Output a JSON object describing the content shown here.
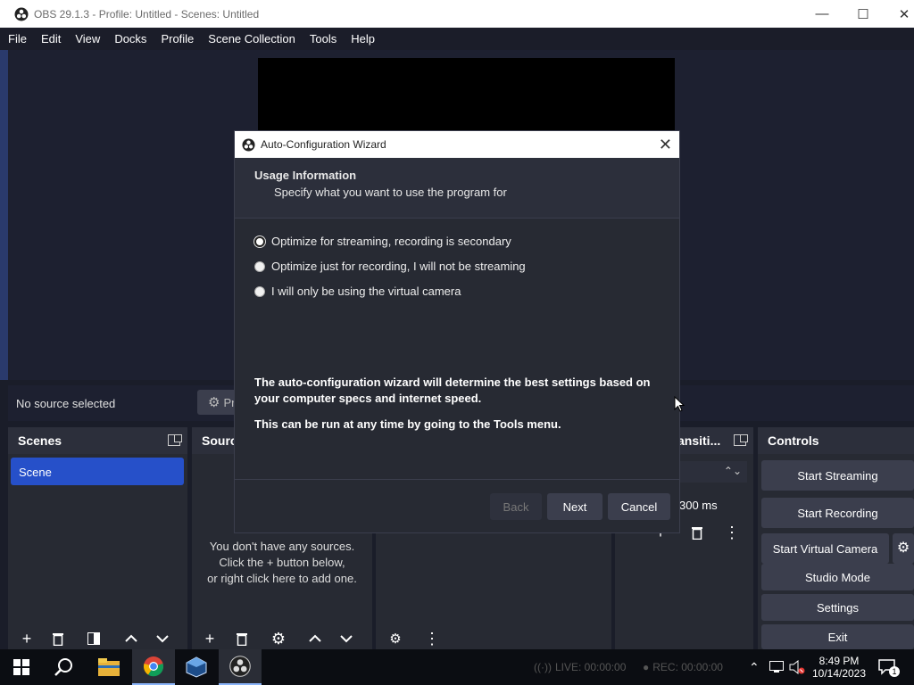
{
  "window": {
    "title": "OBS 29.1.3 - Profile: Untitled - Scenes: Untitled",
    "minimize": "—",
    "maximize": "☐",
    "close": "✕"
  },
  "menu": [
    "File",
    "Edit",
    "View",
    "Docks",
    "Profile",
    "Scene Collection",
    "Tools",
    "Help"
  ],
  "source_bar": {
    "no_source": "No source selected",
    "properties_label": "Pr"
  },
  "scenes": {
    "title": "Scenes",
    "items": [
      "Scene"
    ]
  },
  "sources": {
    "title": "Sourc",
    "empty_lines": [
      "You don't have any sources.",
      "Click the + button below,",
      "or right click here to add one."
    ]
  },
  "transitions": {
    "title": "ansiti...",
    "duration": "300 ms"
  },
  "controls": {
    "title": "Controls",
    "buttons": [
      "Start Streaming",
      "Start Recording",
      "Start Virtual Camera",
      "Studio Mode",
      "Settings",
      "Exit"
    ]
  },
  "dialog": {
    "title": "Auto-Configuration Wizard",
    "close": "✕",
    "header_title": "Usage Information",
    "header_subtitle": "Specify what you want to use the program for",
    "options": [
      {
        "label": "Optimize for streaming, recording is secondary",
        "selected": true
      },
      {
        "label": "Optimize just for recording, I will not be streaming",
        "selected": false
      },
      {
        "label": "I will only be using the virtual camera",
        "selected": false
      }
    ],
    "info1": "The auto-configuration wizard will determine the best settings based on your computer specs and internet speed.",
    "info2": "This can be run at any time by going to the Tools menu.",
    "back": "Back",
    "next": "Next",
    "cancel": "Cancel"
  },
  "status": {
    "live": "LIVE: 00:00:00",
    "rec": "REC: 00:00:00"
  },
  "taskbar": {
    "time": "8:49 PM",
    "date": "10/14/2023",
    "notifications": "1"
  },
  "colors": {
    "accent": "#2650c9",
    "panel": "#272a33",
    "button": "#3b3e4d",
    "background": "#1d2030"
  }
}
